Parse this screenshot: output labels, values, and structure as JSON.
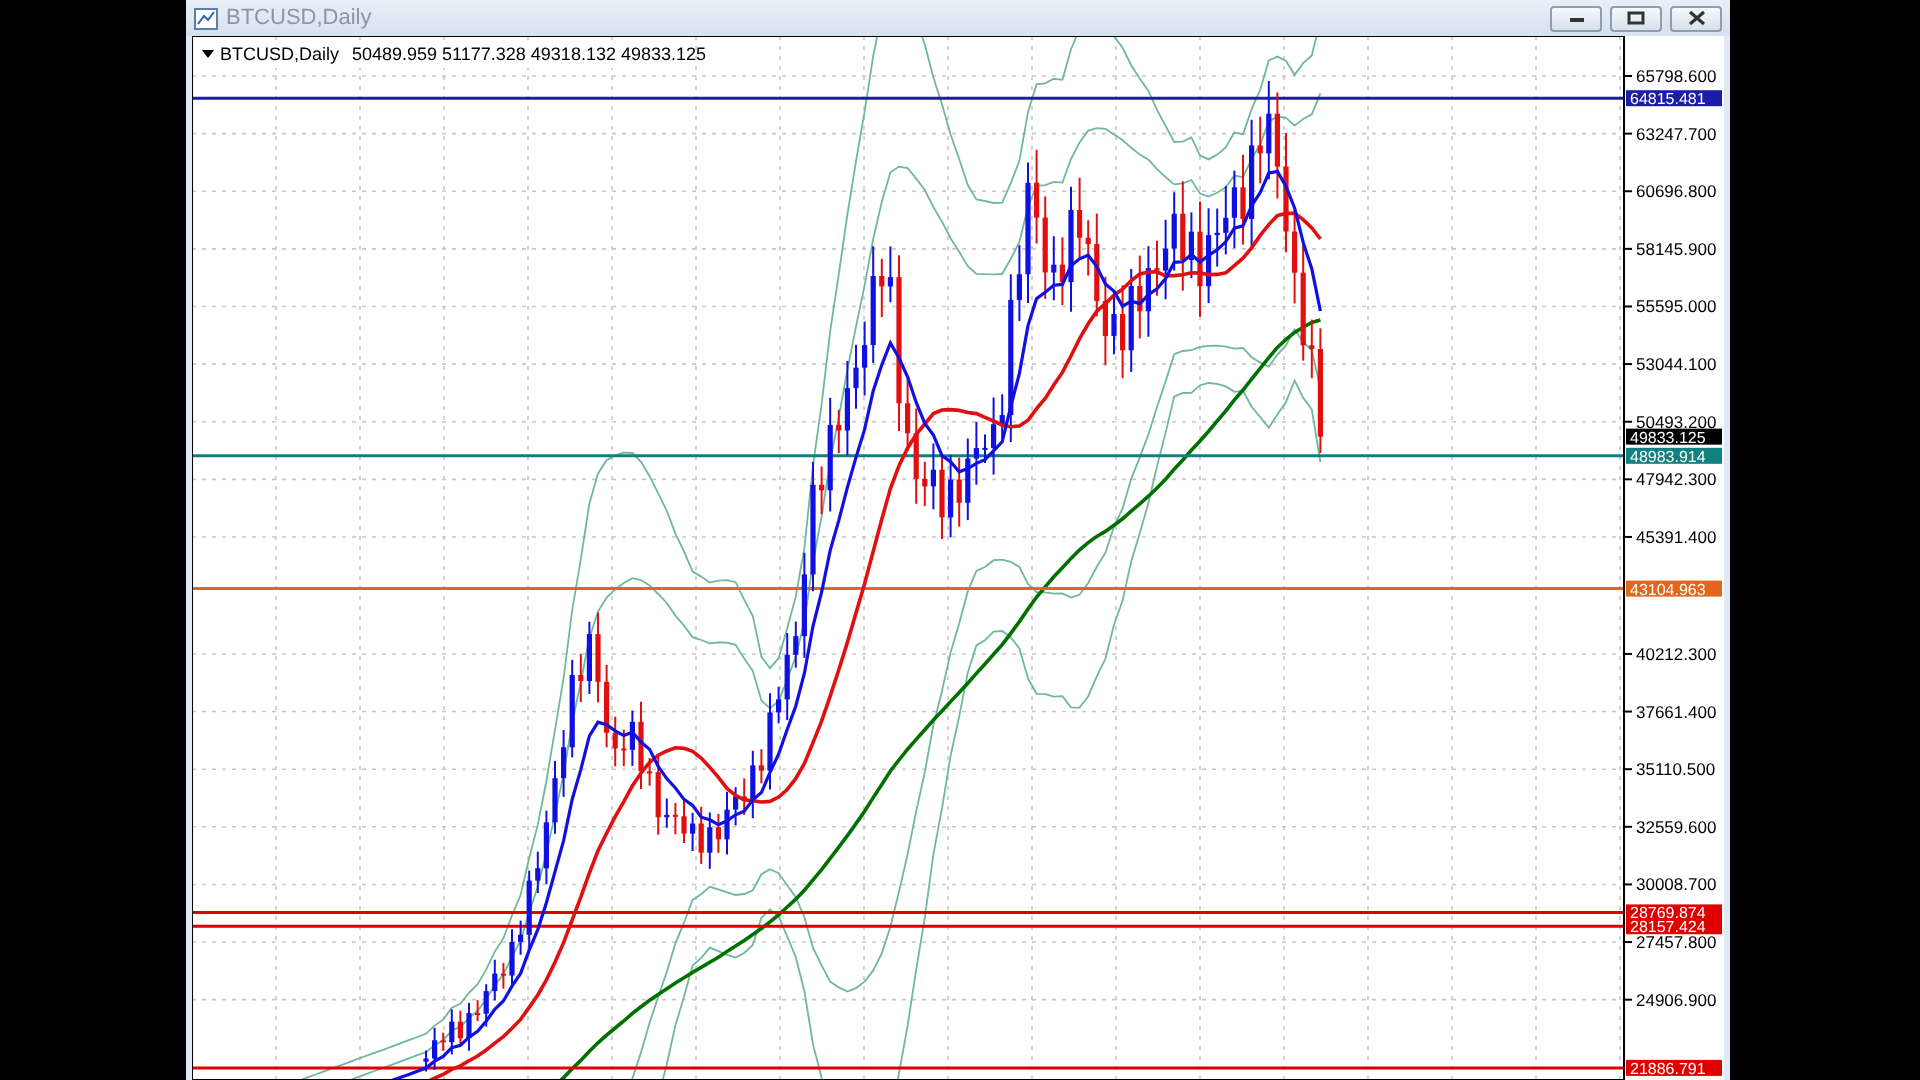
{
  "window": {
    "title": "BTCUSD,Daily"
  },
  "chart": {
    "symbol": "BTCUSD,Daily",
    "ohlc": "50489.959 51177.328 49318.132 49833.125",
    "price_ticks": [
      "65798.600",
      "63247.700",
      "60696.800",
      "58145.900",
      "55595.000",
      "53044.100",
      "50493.200",
      "47942.300",
      "45391.400",
      "40212.300",
      "37661.400",
      "35110.500",
      "32559.600",
      "30008.700",
      "27457.800",
      "24906.900"
    ],
    "levels": [
      {
        "label": "64815.481",
        "color": "#1c1ca8"
      },
      {
        "label": "48983.914",
        "color": "#118080"
      },
      {
        "label": "43104.963",
        "color": "#e2661e"
      },
      {
        "label": "28769.874",
        "color": "#e00000"
      },
      {
        "label": "28157.424",
        "color": "#e00000"
      },
      {
        "label": "21886.791",
        "color": "#e00000"
      }
    ],
    "last_price": "49833.125"
  }
}
